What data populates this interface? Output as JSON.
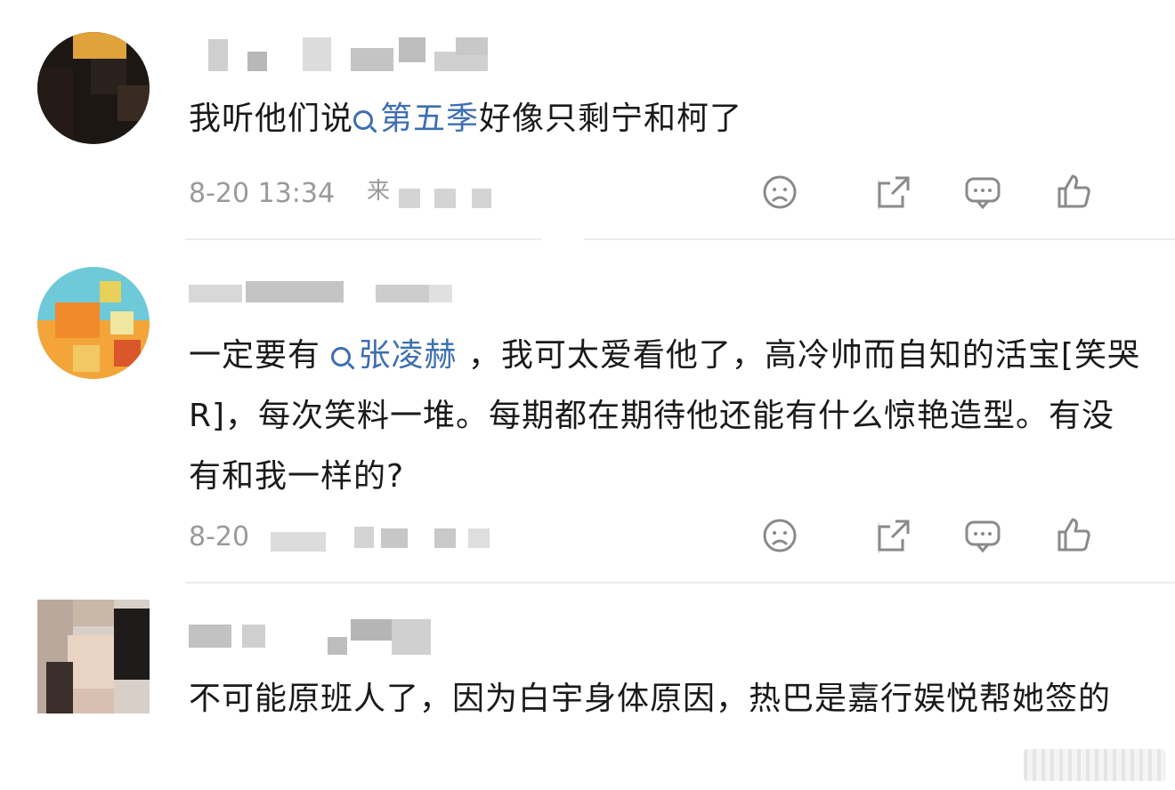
{
  "comments": [
    {
      "text_before": "我听他们说",
      "topic": "第五季",
      "text_after": "好像只剩宁和柯了",
      "time": "8-20 13:34",
      "source_fragment": "来"
    },
    {
      "text_before": "一定要有 ",
      "topic": "张凌赫",
      "text_after": " ，我可太爱看他了，高冷帅而自知的活宝[笑哭R]，每次笑料一堆。每期都在期待他还能有什么惊艳造型。有没有和我一样的?",
      "time": "8-20"
    },
    {
      "text": "不可能原班人了，因为白宇身体原因，热巴是嘉行娱悦帮她签的"
    }
  ],
  "colors": {
    "topic": "#3d6fb0",
    "text": "#1a1a1a",
    "meta": "#9a9a9a",
    "icon": "#8a8a8a"
  },
  "icons": [
    "sad-face-icon",
    "share-icon",
    "comment-icon",
    "like-icon",
    "search-icon"
  ]
}
